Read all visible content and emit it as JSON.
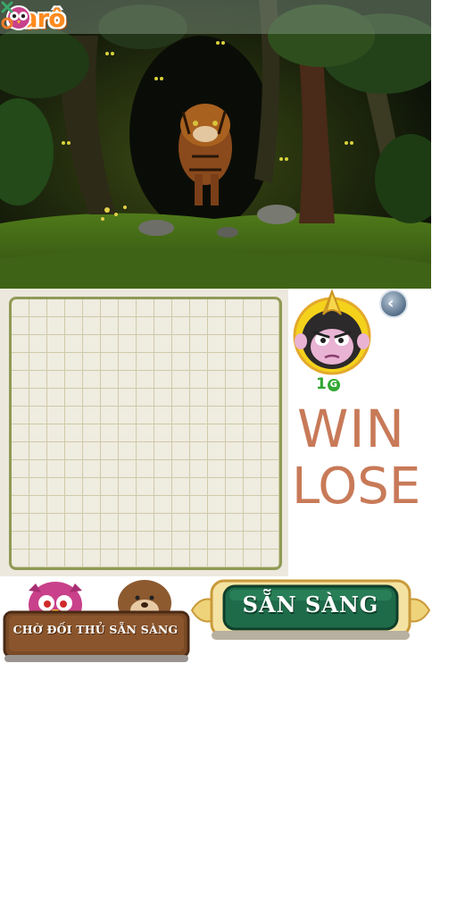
{
  "app": {
    "logo_text": "carô"
  },
  "opponent": {
    "score": "1",
    "score_icon": "coin-icon"
  },
  "result": {
    "win": "WIN",
    "lose": "LOSE"
  },
  "controls": {
    "waiting_label": "CHỜ ĐỐI THỦ SẴN SÀNG",
    "ready_label": "SẴN SÀNG"
  },
  "board": {
    "rows": 15,
    "cols": 15
  },
  "colors": {
    "accent_orange": "#ff8a1e",
    "result_text": "#c87a58",
    "score_green": "#2fa52f",
    "ready_button": "#1e6b4a",
    "board_border": "#8f9a55"
  }
}
